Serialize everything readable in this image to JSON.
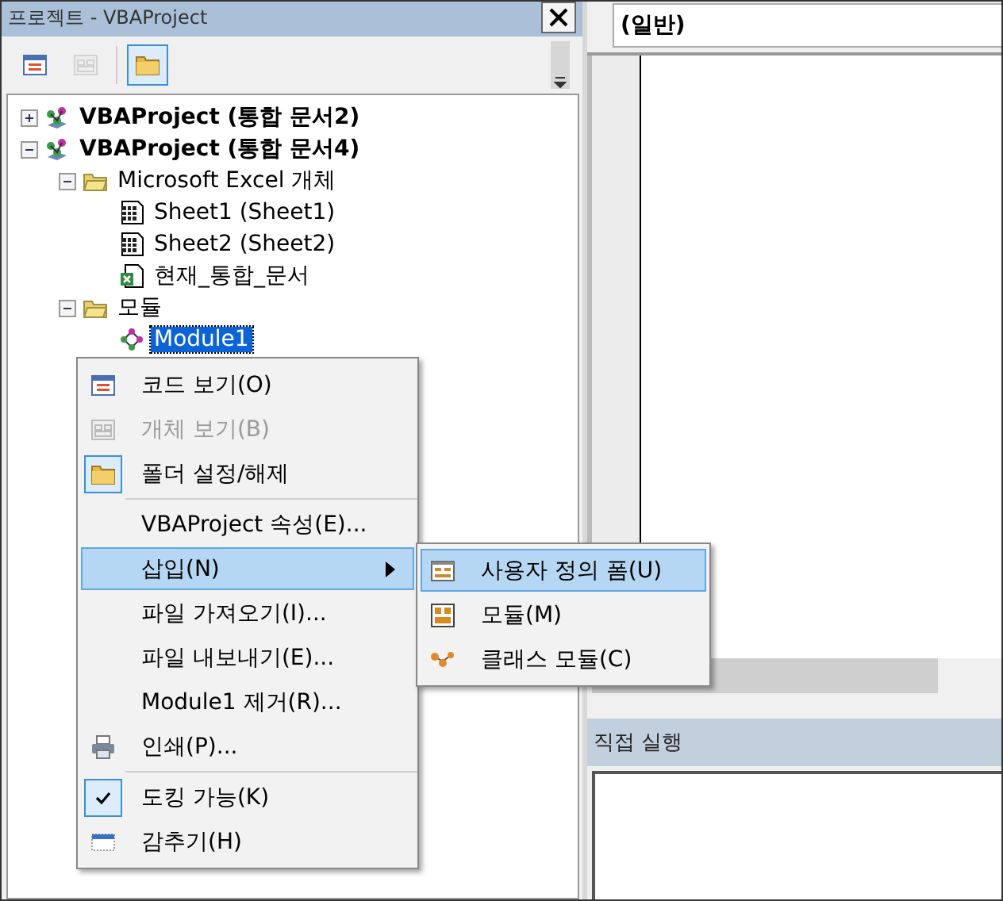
{
  "project_panel": {
    "title": "프로젝트 - VBAProject",
    "toolbar": [
      {
        "kind": "code",
        "selected": false,
        "disabled": false
      },
      {
        "kind": "object",
        "selected": false,
        "disabled": true
      },
      {
        "kind": "folder",
        "selected": true,
        "disabled": false
      }
    ],
    "tree": [
      {
        "label": "VBAProject (통합 문서2)",
        "kind": "project",
        "expanded": false,
        "selected": false
      },
      {
        "label": "VBAProject (통합 문서4)",
        "kind": "project",
        "expanded": true,
        "selected": false,
        "children": [
          {
            "label": "Microsoft Excel 개체",
            "kind": "folder",
            "expanded": true,
            "selected": false,
            "children": [
              {
                "label": "Sheet1 (Sheet1)",
                "kind": "sheet",
                "selected": false
              },
              {
                "label": "Sheet2 (Sheet2)",
                "kind": "sheet",
                "selected": false
              },
              {
                "label": "현재_통합_문서",
                "kind": "workbook",
                "selected": false
              }
            ]
          },
          {
            "label": "모듈",
            "kind": "folder",
            "expanded": true,
            "selected": false,
            "children": [
              {
                "label": "Module1",
                "kind": "module",
                "selected": true
              }
            ]
          }
        ]
      }
    ]
  },
  "context_menu": {
    "items": [
      {
        "label": "코드 보기(O)",
        "kind": "code",
        "disabled": false,
        "checked": false,
        "selected": false
      },
      {
        "label": "개체 보기(B)",
        "kind": "object",
        "disabled": true,
        "checked": false,
        "selected": false
      },
      {
        "label": "폴더 설정/해제",
        "kind": "folder",
        "disabled": false,
        "checked": true,
        "selected": false
      },
      {
        "kind": "separator"
      },
      {
        "label": "VBAProject 속성(E)...",
        "kind": "plain",
        "disabled": false,
        "checked": false,
        "selected": false
      },
      {
        "label": "삽입(N)",
        "kind": "submenu",
        "disabled": false,
        "checked": false,
        "selected": true
      },
      {
        "label": "파일 가져오기(I)...",
        "kind": "plain",
        "disabled": false,
        "checked": false,
        "selected": false
      },
      {
        "label": "파일 내보내기(E)...",
        "kind": "plain",
        "disabled": false,
        "checked": false,
        "selected": false
      },
      {
        "label": "Module1 제거(R)...",
        "kind": "plain",
        "disabled": false,
        "checked": false,
        "selected": false
      },
      {
        "label": "인쇄(P)...",
        "kind": "print",
        "disabled": false,
        "checked": false,
        "selected": false
      },
      {
        "kind": "separator"
      },
      {
        "label": "도킹 가능(K)",
        "kind": "check",
        "disabled": false,
        "checked": true,
        "selected": false
      },
      {
        "label": "감추기(H)",
        "kind": "hide",
        "disabled": false,
        "checked": false,
        "selected": false
      }
    ]
  },
  "submenu": {
    "items": [
      {
        "label": "사용자 정의 폼(U)",
        "kind": "form",
        "selected": true
      },
      {
        "label": "모듈(M)",
        "kind": "module",
        "selected": false
      },
      {
        "label": "클래스 모듈(C)",
        "kind": "class",
        "selected": false
      }
    ]
  },
  "code_window": {
    "procedure_combo": "(일반)"
  },
  "immediate_window": {
    "title": "직접 실행"
  }
}
